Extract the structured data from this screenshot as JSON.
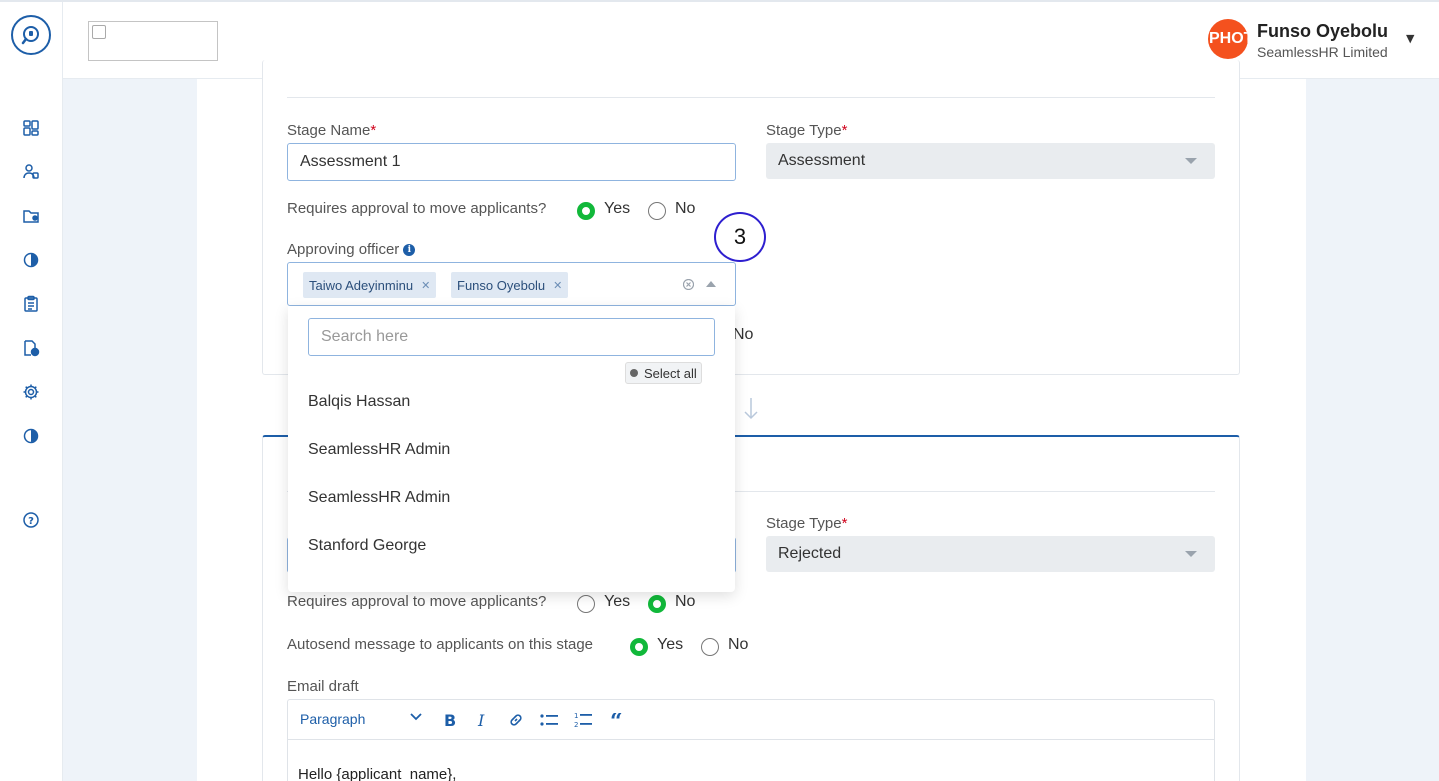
{
  "header": {
    "user_name": "Funso Oyebolu",
    "user_org": "SeamlessHR Limited",
    "avatar_text": "PHOTO"
  },
  "sidebar": {
    "icons": [
      "dashboard-icon",
      "users-icon",
      "folder-user-icon",
      "pie-chart-icon",
      "clipboard-icon",
      "document-clock-icon",
      "gear-icon",
      "pie-chart-icon",
      "help-icon"
    ]
  },
  "stage1": {
    "stage_name_label": "Stage Name",
    "stage_name_value": "Assessment 1",
    "stage_type_label": "Stage Type",
    "stage_type_value": "Assessment",
    "approval_question": "Requires approval to move applicants?",
    "approval_selected": "Yes",
    "yes_label": "Yes",
    "no_label": "No",
    "approving_officer_label": "Approving officer",
    "selected_officers": [
      "Taiwo Adeyinminu",
      "Funso Oyebolu"
    ],
    "hidden_no_label": "No"
  },
  "step_marker": "3",
  "dropdown": {
    "search_placeholder": "Search here",
    "select_all_label": "Select all",
    "options": [
      "Balqis Hassan",
      "SeamlessHR Admin",
      "SeamlessHR Admin",
      "Stanford George"
    ]
  },
  "stage2": {
    "stage_type_label": "Stage Type",
    "stage_type_value": "Rejected",
    "approval_question": "Requires approval to move applicants?",
    "approval_selected": "No",
    "yes_label": "Yes",
    "no_label": "No",
    "autosend_question": "Autosend message to applicants on this stage",
    "autosend_selected": "Yes",
    "email_draft_label": "Email draft",
    "editor_format": "Paragraph",
    "editor_body": "Hello {applicant_name},"
  },
  "colors": {
    "primary": "#1d5ea8",
    "radio_on": "#11b83a",
    "required": "#d0021b",
    "step_circle": "#2e1fcf",
    "avatar": "#f4511e"
  }
}
